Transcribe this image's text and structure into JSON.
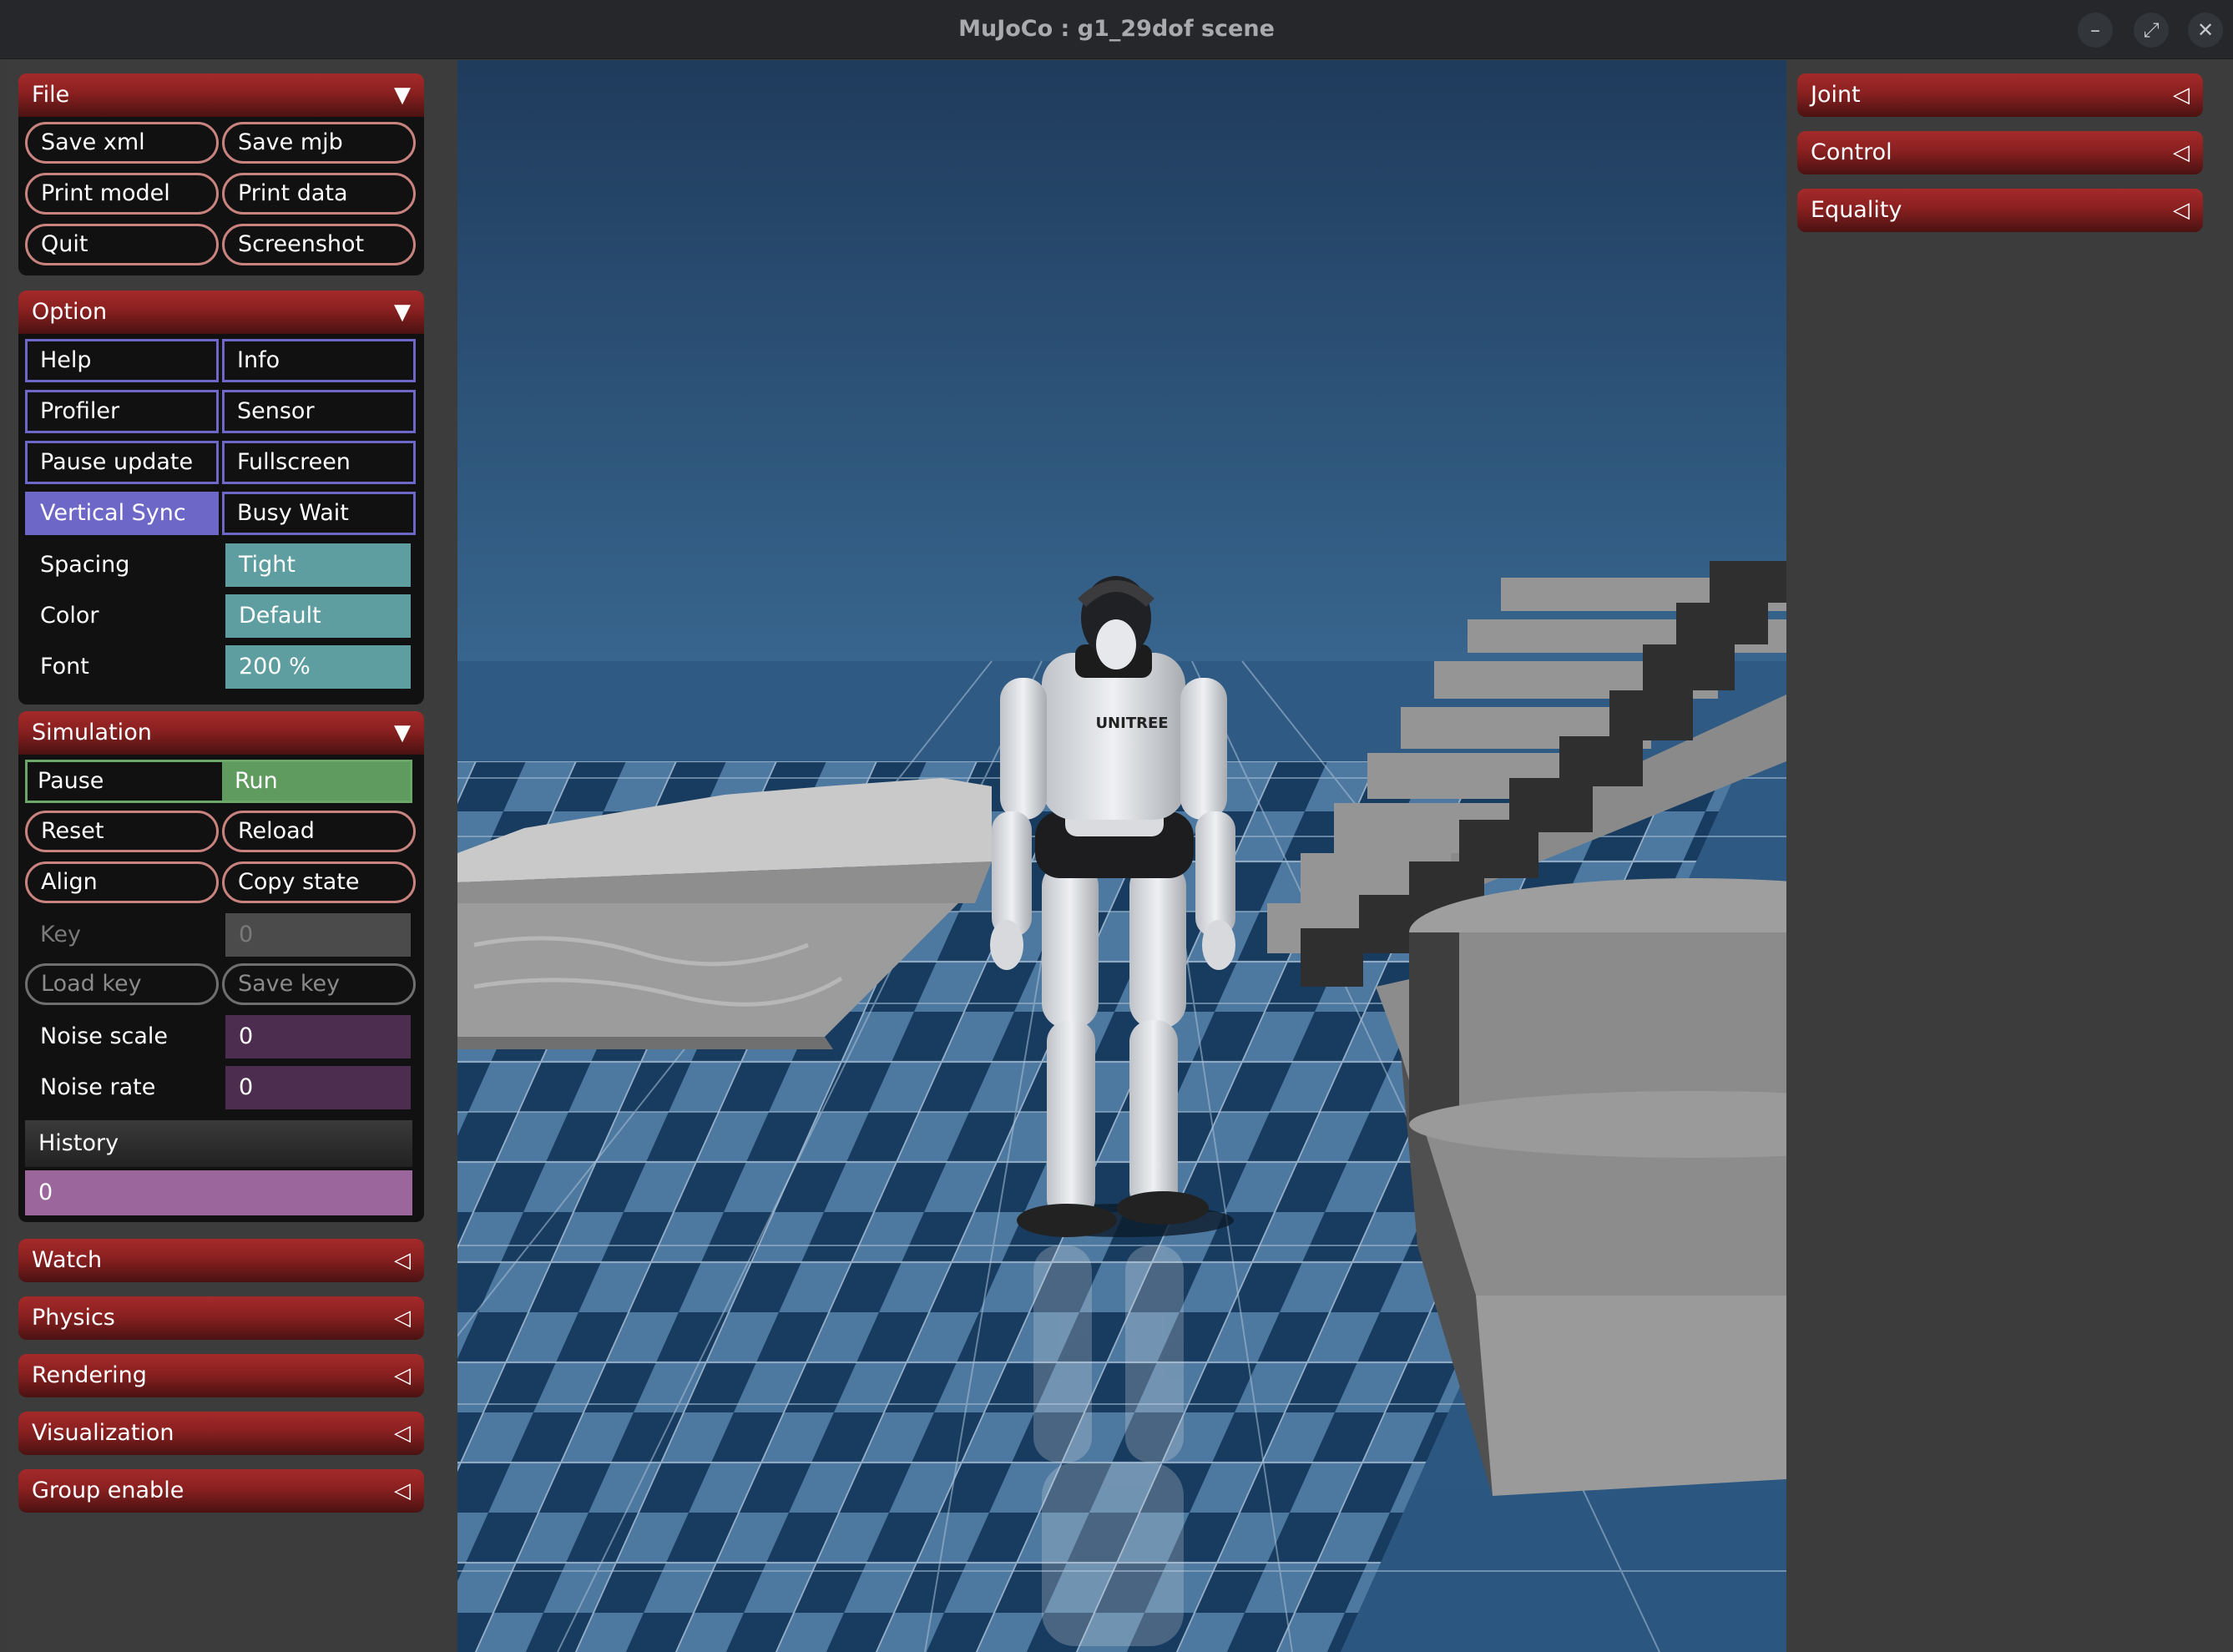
{
  "window": {
    "title": "MuJoCo : g1_29dof scene",
    "minimize_glyph": "–",
    "maximize_glyph": "⤢",
    "close_glyph": "✕"
  },
  "left_panel": {
    "file": {
      "title": "File",
      "arrow": "▼",
      "buttons": [
        "Save xml",
        "Save mjb",
        "Print model",
        "Print data",
        "Quit",
        "Screenshot"
      ]
    },
    "option": {
      "title": "Option",
      "arrow": "▼",
      "toggles": [
        "Help",
        "Info",
        "Profiler",
        "Sensor",
        "Pause update",
        "Fullscreen",
        "Vertical Sync",
        "Busy Wait"
      ],
      "vertical_sync_on": true,
      "spacing": {
        "label": "Spacing",
        "value": "Tight"
      },
      "color": {
        "label": "Color",
        "value": "Default"
      },
      "font": {
        "label": "Font",
        "value": "200 %"
      }
    },
    "simulation": {
      "title": "Simulation",
      "arrow": "▼",
      "pause_label": "Pause",
      "run_label": "Run",
      "mode": "Run",
      "buttons": [
        "Reset",
        "Reload",
        "Align",
        "Copy state"
      ],
      "key": {
        "label": "Key",
        "value": "0"
      },
      "load_key": "Load key",
      "save_key": "Save key",
      "noise_scale": {
        "label": "Noise scale",
        "value": "0"
      },
      "noise_rate": {
        "label": "Noise rate",
        "value": "0"
      },
      "history": {
        "label": "History",
        "value": "0"
      }
    },
    "collapsed": [
      {
        "title": "Watch",
        "arrow": "◁"
      },
      {
        "title": "Physics",
        "arrow": "◁"
      },
      {
        "title": "Rendering",
        "arrow": "◁"
      },
      {
        "title": "Visualization",
        "arrow": "◁"
      },
      {
        "title": "Group enable",
        "arrow": "◁"
      }
    ]
  },
  "right_panel": {
    "collapsed": [
      {
        "title": "Joint",
        "arrow": "◁"
      },
      {
        "title": "Control",
        "arrow": "◁"
      },
      {
        "title": "Equality",
        "arrow": "◁"
      }
    ]
  },
  "scene": {
    "robot_logo": "UNITREE",
    "colors": {
      "sky_top": "#1f3b5c",
      "sky_bottom": "#3a6a93",
      "tile_dark": "#173a5e",
      "tile_light": "#4f7aa2",
      "geometry": "#8a8a8a"
    }
  }
}
